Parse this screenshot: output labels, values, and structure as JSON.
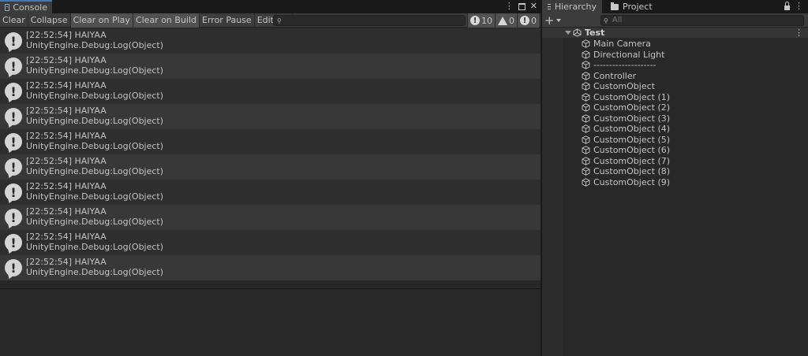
{
  "console": {
    "tab_label": "Console",
    "window_controls": {
      "menu": "⋮",
      "close": "✕"
    },
    "toolbar": {
      "clear": "Clear",
      "collapse": "Collapse",
      "clear_on_play": "Clear on Play",
      "clear_on_build": "Clear on Build",
      "error_pause": "Error Pause",
      "editor": "Editor"
    },
    "search_placeholder": "",
    "counts": {
      "info": "10",
      "warnings": "0",
      "errors": "0"
    },
    "logs": [
      {
        "line1": "[22:52:54] HAIYAA",
        "line2": "UnityEngine.Debug:Log(Object)"
      },
      {
        "line1": "[22:52:54] HAIYAA",
        "line2": "UnityEngine.Debug:Log(Object)"
      },
      {
        "line1": "[22:52:54] HAIYAA",
        "line2": "UnityEngine.Debug:Log(Object)"
      },
      {
        "line1": "[22:52:54] HAIYAA",
        "line2": "UnityEngine.Debug:Log(Object)"
      },
      {
        "line1": "[22:52:54] HAIYAA",
        "line2": "UnityEngine.Debug:Log(Object)"
      },
      {
        "line1": "[22:52:54] HAIYAA",
        "line2": "UnityEngine.Debug:Log(Object)"
      },
      {
        "line1": "[22:52:54] HAIYAA",
        "line2": "UnityEngine.Debug:Log(Object)"
      },
      {
        "line1": "[22:52:54] HAIYAA",
        "line2": "UnityEngine.Debug:Log(Object)"
      },
      {
        "line1": "[22:52:54] HAIYAA",
        "line2": "UnityEngine.Debug:Log(Object)"
      },
      {
        "line1": "[22:52:54] HAIYAA",
        "line2": "UnityEngine.Debug:Log(Object)"
      }
    ]
  },
  "hierarchy": {
    "tab_hierarchy": "Hierarchy",
    "tab_project": "Project",
    "controls": {
      "menu": "⋮"
    },
    "add_label": "+",
    "search_placeholder": "All",
    "scene": {
      "name": "Test",
      "menu": "⋮"
    },
    "items": [
      "Main Camera",
      "Directional Light",
      "--------------------",
      "Controller",
      "CustomObject",
      "CustomObject (1)",
      "CustomObject (2)",
      "CustomObject (3)",
      "CustomObject (4)",
      "CustomObject (5)",
      "CustomObject (6)",
      "CustomObject (7)",
      "CustomObject (8)",
      "CustomObject (9)"
    ]
  }
}
